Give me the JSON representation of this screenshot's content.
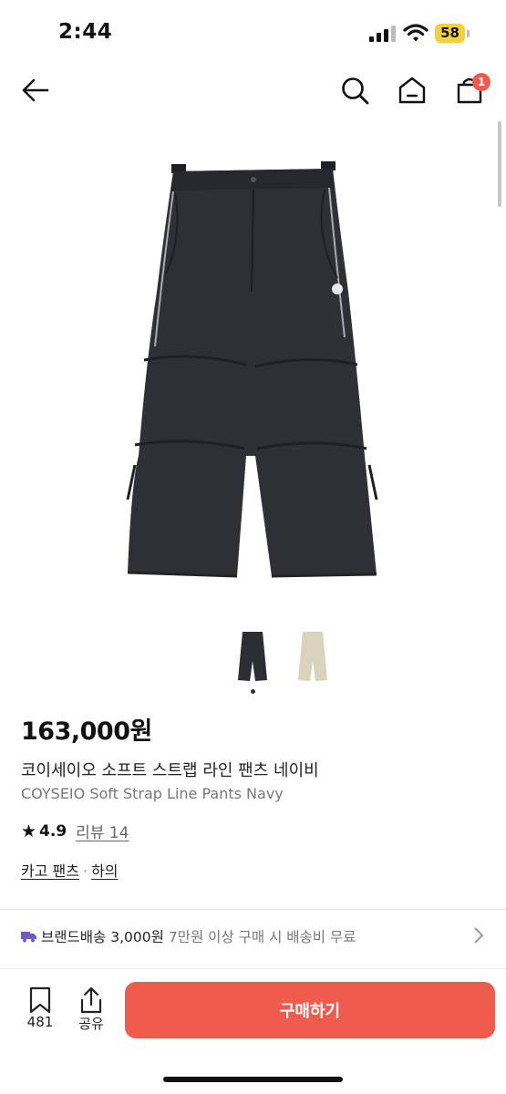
{
  "status_bar": {
    "time": "2:44",
    "battery": "58"
  },
  "nav": {
    "back_icon": "arrow-left-icon",
    "search_icon": "search-icon",
    "home_icon": "home-icon",
    "cart_icon": "shopping-bag-icon",
    "cart_count": "1"
  },
  "product": {
    "price": "163,000원",
    "name_ko": "코이세이오 소프트 스트랩 라인 팬츠 네이비",
    "name_en": "COYSEIO Soft Strap Line Pants Navy",
    "rating": "4.9",
    "review_label": "리뷰 14",
    "category": "카고 팬츠",
    "category_sep": "·",
    "subcategory": "하의",
    "thumbnails": [
      {
        "color_name": "navy",
        "color": "#2b2d33"
      },
      {
        "color_name": "beige",
        "color": "#d9d3bd"
      }
    ]
  },
  "shipping": {
    "main": "브랜드배송 3,000원",
    "sub": "7만원 이상 구매 시 배송비 무료"
  },
  "bottom_bar": {
    "bookmark_count": "481",
    "share_label": "공유",
    "buy_label": "구매하기"
  },
  "colors": {
    "accent": "#ef5b4d",
    "text": "#111111",
    "muted": "#777777",
    "shipping_icon": "#6b5cc9"
  }
}
